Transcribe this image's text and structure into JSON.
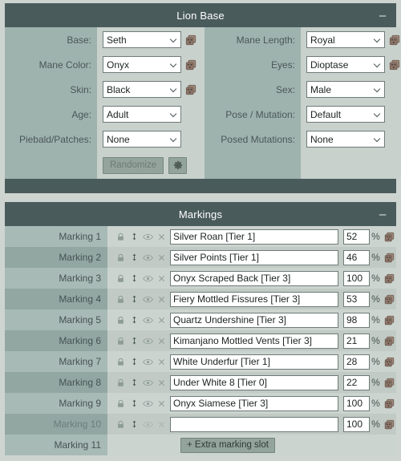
{
  "theme": {
    "page_bg": "#ced5d0",
    "panel_header_bg": "#4a5b5c",
    "panel_header_text": "#ffffff",
    "label_col_bg": "#9fb3ae",
    "field_col_bg": "#c9d1cd",
    "row_odd_bg": "#a8bab5",
    "row_even_bg": "#92a7a2",
    "input_bg": "#ffffff",
    "input_border": "#6f7b79",
    "button_bg": "#93a49c",
    "dice_color": "#8b7465"
  },
  "lion_base": {
    "title": "Lion Base",
    "collapse_label": "–",
    "left_fields": [
      {
        "label": "Base:",
        "value": "Seth",
        "dice": true
      },
      {
        "label": "Mane Color:",
        "value": "Onyx",
        "dice": true
      },
      {
        "label": "Skin:",
        "value": "Black",
        "dice": true
      },
      {
        "label": "Age:",
        "value": "Adult",
        "dice": false
      },
      {
        "label": "Piebald/Patches:",
        "value": "None",
        "dice": false
      }
    ],
    "right_fields": [
      {
        "label": "Mane Length:",
        "value": "Royal",
        "dice": true
      },
      {
        "label": "Eyes:",
        "value": "Dioptase",
        "dice": true
      },
      {
        "label": "Sex:",
        "value": "Male",
        "dice": false
      },
      {
        "label": "Pose / Mutation:",
        "value": "Default",
        "dice": false
      },
      {
        "label": "Posed Mutations:",
        "value": "None",
        "dice": false
      }
    ],
    "randomize_label": "Randomize",
    "gear_icon": "gear-icon",
    "dice_icon": "dice-icon"
  },
  "markings": {
    "title": "Markings",
    "collapse_label": "–",
    "percent_sign": "%",
    "row_icons": [
      "lock-icon",
      "updown-arrow-icon",
      "eye-icon",
      "close-x-icon"
    ],
    "rows": [
      {
        "name": "Marking 1",
        "marking": "Silver Roan [Tier 1]",
        "percent": "52",
        "disabled": false
      },
      {
        "name": "Marking 2",
        "marking": "Silver Points [Tier 1]",
        "percent": "46",
        "disabled": false
      },
      {
        "name": "Marking 3",
        "marking": "Onyx Scraped Back [Tier 3]",
        "percent": "100",
        "disabled": false
      },
      {
        "name": "Marking 4",
        "marking": "Fiery Mottled Fissures [Tier 3]",
        "percent": "53",
        "disabled": false
      },
      {
        "name": "Marking 5",
        "marking": "Quartz Undershine [Tier 3]",
        "percent": "98",
        "disabled": false
      },
      {
        "name": "Marking 6",
        "marking": "Kimanjano Mottled Vents [Tier 3]",
        "percent": "21",
        "disabled": false
      },
      {
        "name": "Marking 7",
        "marking": "White Underfur [Tier 1]",
        "percent": "28",
        "disabled": false
      },
      {
        "name": "Marking 8",
        "marking": "Under White 8 [Tier 0]",
        "percent": "22",
        "disabled": false
      },
      {
        "name": "Marking 9",
        "marking": "Onyx Siamese [Tier 3]",
        "percent": "100",
        "disabled": false
      },
      {
        "name": "Marking 10",
        "marking": "",
        "percent": "100",
        "disabled": true
      }
    ],
    "extra_row": {
      "name": "Marking 11",
      "button_label": "+ Extra marking slot"
    },
    "marking_placeholder": ""
  }
}
